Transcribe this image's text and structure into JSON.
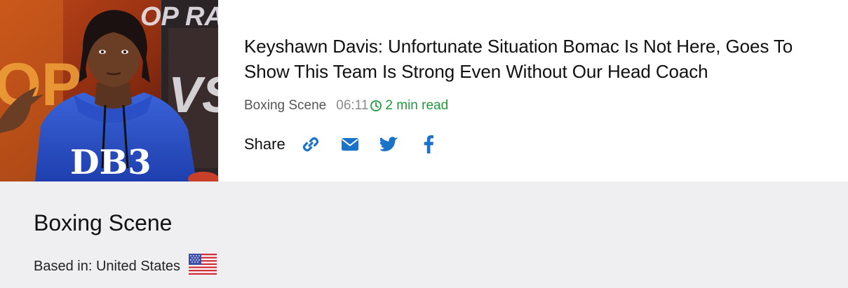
{
  "article": {
    "headline": "Keyshawn Davis: Unfortunate Situation Bomac Is Not Here, Goes To Show This Team Is Strong Even Without Our Head Coach",
    "source": "Boxing Scene",
    "time": "06:11",
    "read_time": "2 min read",
    "image": {
      "shirt_text": "DB3",
      "backdrop_top": "OP RA",
      "backdrop_left": "OP",
      "backdrop_right": "VS"
    }
  },
  "share": {
    "label": "Share",
    "icons": [
      "link-icon",
      "email-icon",
      "twitter-icon",
      "facebook-icon"
    ],
    "icon_color": "#1a73c8"
  },
  "publisher": {
    "name": "Boxing Scene",
    "based_in": "Based in: United States",
    "flag": "us-flag-icon"
  },
  "colors": {
    "read_time": "#1e9b3c",
    "publisher_bg": "#efeff2"
  }
}
